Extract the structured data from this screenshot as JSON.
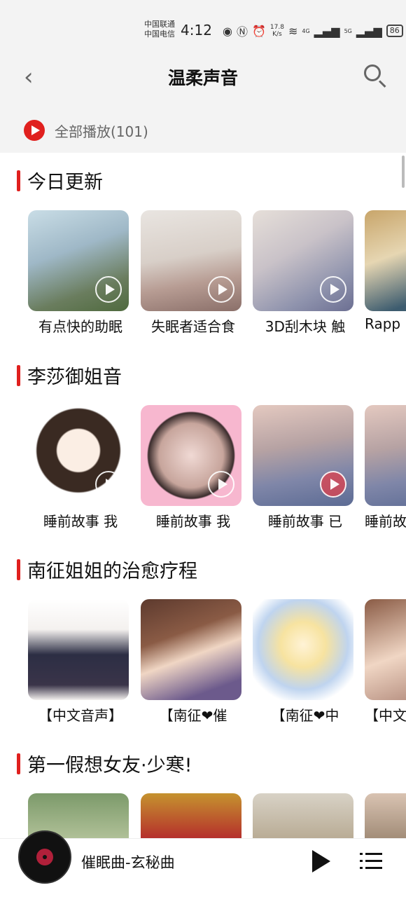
{
  "status_bar": {
    "carrier_1": "中国联通",
    "carrier_2": "中国电信",
    "time": "4:12",
    "net_speed_value": "17.8",
    "net_speed_unit": "K/s",
    "signal_1": "4G",
    "signal_2": "5G",
    "battery": "86",
    "icons": [
      "eye-icon",
      "nfc-icon",
      "alarm-icon",
      "wifi-icon",
      "signal-icon",
      "battery-icon"
    ]
  },
  "header": {
    "title": "温柔声音",
    "back_icon": "chevron-left-icon",
    "search_icon": "search-icon"
  },
  "play_all": {
    "label": "全部播放(101)"
  },
  "sections": [
    {
      "title": "今日更新",
      "items": [
        {
          "caption": "有点快的助眠"
        },
        {
          "caption": "失眠者适合食"
        },
        {
          "caption": "3D刮木块 触"
        },
        {
          "caption": "Rapp"
        }
      ]
    },
    {
      "title": "李莎御姐音",
      "items": [
        {
          "caption": "睡前故事 我"
        },
        {
          "caption": "睡前故事 我"
        },
        {
          "caption": "睡前故事 已"
        },
        {
          "caption": "睡前故"
        }
      ]
    },
    {
      "title": "南征姐姐的治愈疗程",
      "items": [
        {
          "caption": "【中文音声】"
        },
        {
          "caption": "【南征❤催"
        },
        {
          "caption": "【南征❤中"
        },
        {
          "caption": "【中文"
        }
      ]
    },
    {
      "title": "第一假想女友·少寒!",
      "items": [
        {
          "caption": ""
        },
        {
          "caption": ""
        },
        {
          "caption": ""
        },
        {
          "caption": ""
        }
      ]
    }
  ],
  "player": {
    "song": "催眠曲-玄秘曲"
  },
  "colors": {
    "accent": "#e0201e",
    "background": "#f3f3f3"
  }
}
